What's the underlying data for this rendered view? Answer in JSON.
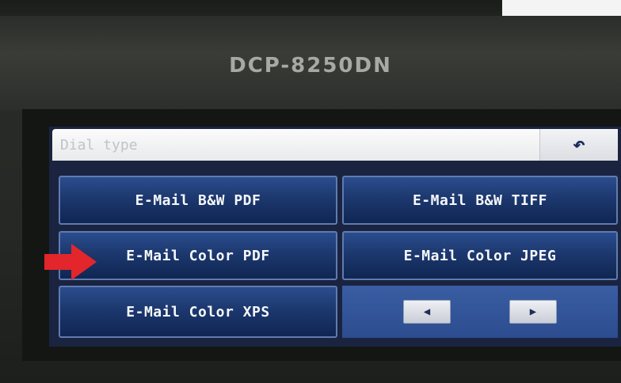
{
  "device": {
    "model": "DCP-8250DN"
  },
  "display": {
    "text": "Dial type",
    "back_icon": "back-arrow-icon"
  },
  "buttons": [
    {
      "label": "E-Mail B&W PDF"
    },
    {
      "label": "E-Mail B&W TIFF"
    },
    {
      "label": "E-Mail Color PDF"
    },
    {
      "label": "E-Mail Color JPEG"
    },
    {
      "label": "E-Mail Color XPS"
    }
  ],
  "nav": {
    "prev_icon": "left-arrow-icon",
    "next_icon": "right-arrow-icon"
  },
  "colors": {
    "button_blue": "#1c386e",
    "display_white": "#f2f3f5",
    "annotation_red": "#e3262b"
  }
}
